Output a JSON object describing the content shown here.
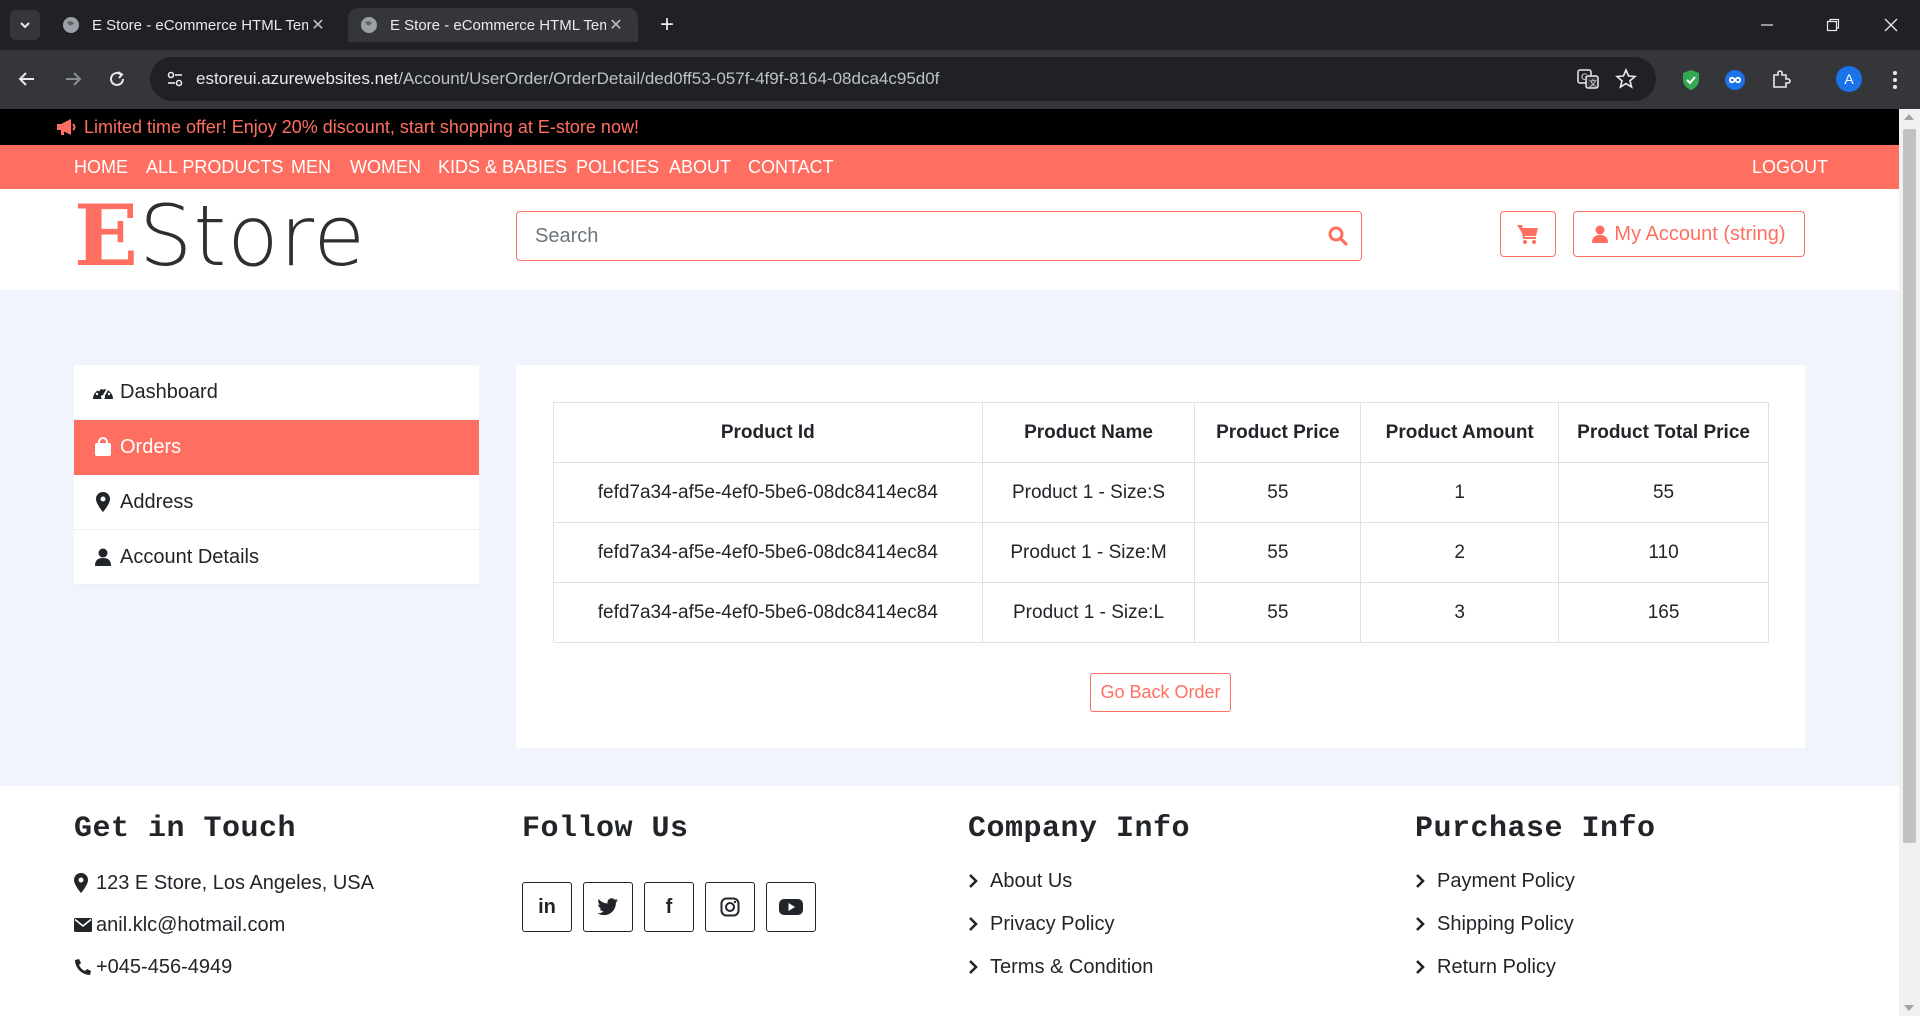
{
  "browser": {
    "tabs": [
      {
        "title": "E Store - eCommerce HTML Template"
      },
      {
        "title": "E Store - eCommerce HTML Template"
      }
    ],
    "url_host": "estoreui.azurewebsites.net",
    "url_path": "/Account/UserOrder/OrderDetail/ded0ff53-057f-4f9f-8164-08dca4c95d0f",
    "profile_initial": "A"
  },
  "promo": {
    "text": "Limited time offer! Enjoy 20% discount, start shopping at E-store now!"
  },
  "nav": {
    "items": [
      "HOME",
      "ALL PRODUCTS",
      "MEN",
      "WOMEN",
      "KIDS & BABIES",
      "POLICIES",
      "ABOUT",
      "CONTACT"
    ],
    "logout": "LOGOUT"
  },
  "header": {
    "logo_first": "E",
    "logo_rest": "Store",
    "search_placeholder": "Search",
    "account_label": "My Account (string)"
  },
  "sidebar": {
    "items": [
      {
        "label": "Dashboard",
        "icon": "dashboard-icon"
      },
      {
        "label": "Orders",
        "icon": "shopping-bag-icon",
        "active": true
      },
      {
        "label": "Address",
        "icon": "map-marker-icon"
      },
      {
        "label": "Account Details",
        "icon": "user-icon"
      }
    ]
  },
  "orders": {
    "columns": [
      "Product Id",
      "Product Name",
      "Product Price",
      "Product Amount",
      "Product Total Price"
    ],
    "rows": [
      [
        "fefd7a34-af5e-4ef0-5be6-08dc8414ec84",
        "Product 1 - Size:S",
        "55",
        "1",
        "55"
      ],
      [
        "fefd7a34-af5e-4ef0-5be6-08dc8414ec84",
        "Product 1 - Size:M",
        "55",
        "2",
        "110"
      ],
      [
        "fefd7a34-af5e-4ef0-5be6-08dc8414ec84",
        "Product 1 - Size:L",
        "55",
        "3",
        "165"
      ]
    ],
    "back_label": "Go Back Order"
  },
  "footer": {
    "contact": {
      "title": "Get in Touch",
      "address": "123 E Store, Los Angeles, USA",
      "email": "anil.klc@hotmail.com",
      "phone": "+045-456-4949"
    },
    "follow": {
      "title": "Follow Us",
      "networks": [
        {
          "icon": "linkedin-icon",
          "glyph": "in"
        },
        {
          "icon": "twitter-icon",
          "glyph": ""
        },
        {
          "icon": "facebook-icon",
          "glyph": "f"
        },
        {
          "icon": "instagram-icon",
          "glyph": ""
        },
        {
          "icon": "youtube-icon",
          "glyph": ""
        }
      ]
    },
    "company": {
      "title": "Company Info",
      "links": [
        "About Us",
        "Privacy Policy",
        "Terms & Condition"
      ]
    },
    "purchase": {
      "title": "Purchase Info",
      "links": [
        "Payment Policy",
        "Shipping Policy",
        "Return Policy"
      ]
    }
  },
  "colors": {
    "accent": "#ff6f61",
    "page_bg": "#f1f4fd",
    "chrome_dark": "#202124",
    "chrome_bar": "#35363a"
  }
}
